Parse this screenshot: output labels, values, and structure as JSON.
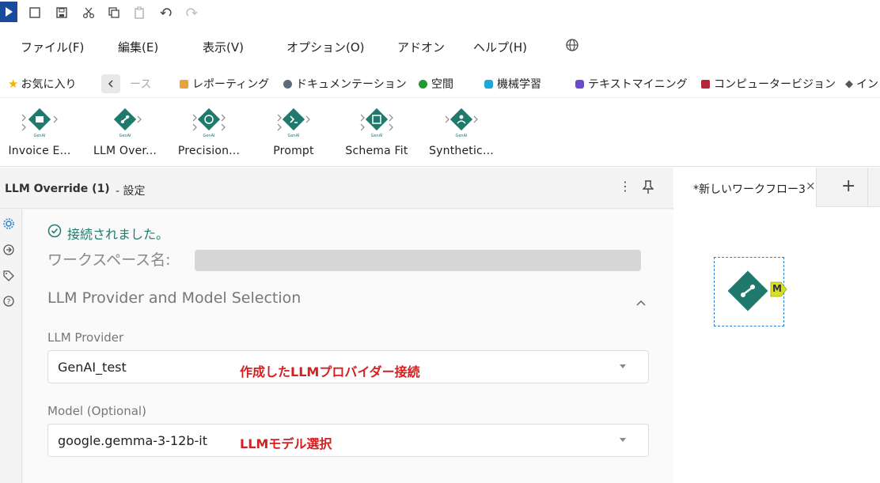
{
  "toolbar": {
    "icons": [
      "app-logo-icon",
      "new-file-icon",
      "save-icon",
      "cut-icon",
      "copy-icon",
      "paste-icon",
      "undo-icon",
      "redo-icon"
    ]
  },
  "menu": {
    "items": [
      "ファイル(F)",
      "編集(E)",
      "表示(V)",
      "オプション(O)",
      "アドオン",
      "ヘルプ(H)"
    ],
    "globe_icon": "globe-icon"
  },
  "favorites": {
    "label": "お気に入り",
    "partial": "ース",
    "items": [
      {
        "label": "レポーティング",
        "color": "#e8a33a"
      },
      {
        "label": "ドキュメンテーション",
        "color": "#5a6b7c"
      },
      {
        "label": "空間",
        "color": "#1e9a2e"
      },
      {
        "label": "機械学習",
        "color": "#1ea8d8"
      },
      {
        "label": "テキストマイニング",
        "color": "#6a4bd0"
      },
      {
        "label": "コンピュータービジョン",
        "color": "#b2263a"
      },
      {
        "label": "イン",
        "color": "#555555"
      }
    ]
  },
  "palette": {
    "tools": [
      {
        "label": "Invoice E..."
      },
      {
        "label": "LLM Over..."
      },
      {
        "label": "Precision..."
      },
      {
        "label": "Prompt"
      },
      {
        "label": "Schema Fit"
      },
      {
        "label": "Synthetic..."
      }
    ]
  },
  "config": {
    "title": "LLM Override (1)",
    "suffix": " - 設定",
    "connected": "接続されました。",
    "workspace_label": "ワークスペース名:",
    "section_title": "LLM Provider and Model Selection",
    "provider_label": "LLM Provider",
    "provider_value": "GenAI_test",
    "provider_note": "作成したLLMプロバイダー接続",
    "model_label": "Model (Optional)",
    "model_value": "google.gemma-3-12b-it",
    "model_note": "LLMモデル選択"
  },
  "canvas": {
    "tab_label": "*新しいワークフロー3",
    "node_anchor": "M"
  },
  "colors": {
    "accent_green": "#1f7a6d",
    "annotation_red": "#d42020",
    "anchor_yellow": "#d9e021"
  }
}
